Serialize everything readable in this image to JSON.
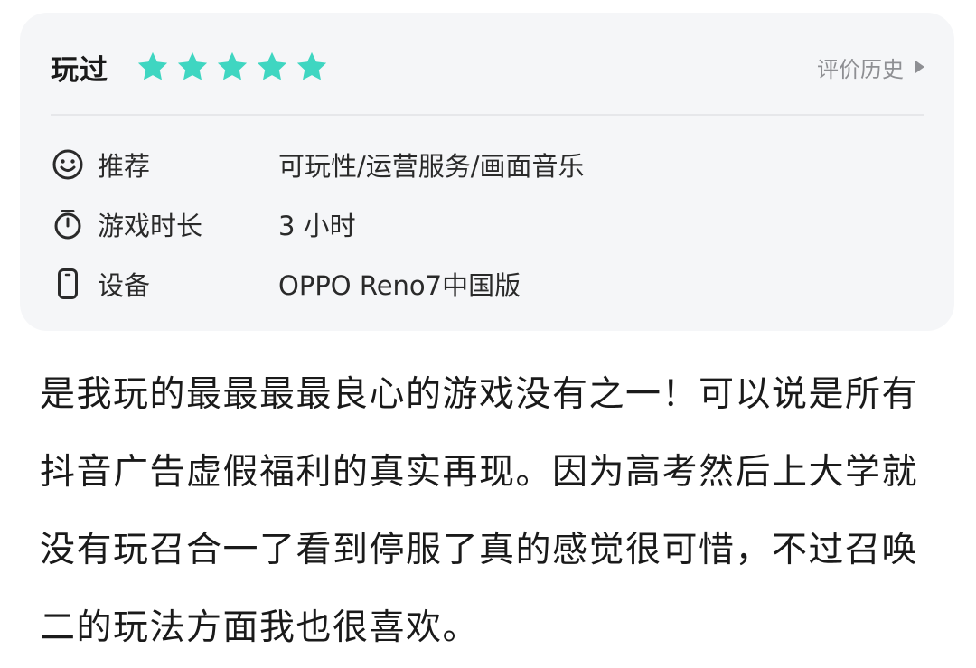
{
  "header": {
    "status": "玩过",
    "rating": 5,
    "rating_max": 5,
    "history_label": "评价历史",
    "icons": {
      "star": "star-icon",
      "history_arrow": "play-arrow-icon"
    }
  },
  "info": {
    "recommend": {
      "icon": "smiley-face-icon",
      "label": "推荐",
      "value": "可玩性/运营服务/画面音乐"
    },
    "playtime": {
      "icon": "stopwatch-icon",
      "label": "游戏时长",
      "value": "3 小时"
    },
    "device": {
      "icon": "phone-icon",
      "label": "设备",
      "value": "OPPO Reno7中国版"
    }
  },
  "review_text": "是我玩的最最最最良心的游戏没有之一！可以说是所有抖音广告虚假福利的真实再现。因为高考然后上大学就没有玩召合一了看到停服了真的感觉很可惜，不过召唤二的玩法方面我也很喜欢。",
  "colors": {
    "star": "#3fd6c1",
    "card_background": "#f5f6f8",
    "muted_text": "#8e8f93"
  }
}
